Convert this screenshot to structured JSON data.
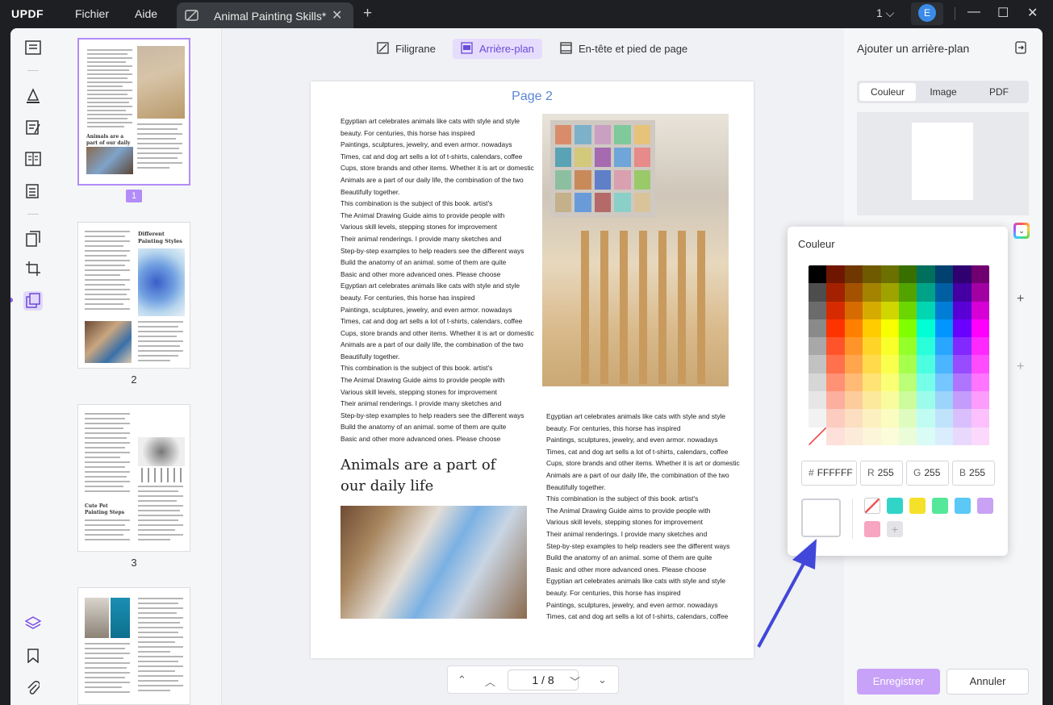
{
  "app": {
    "logo": "UPDF",
    "menu": [
      "Fichier",
      "Aide"
    ]
  },
  "tab": {
    "title": "Animal Painting Skills*"
  },
  "topbar": {
    "page_indicator": "1",
    "avatar_initial": "E"
  },
  "toolbar": {
    "watermark": "Filigrane",
    "background": "Arrière-plan",
    "header_footer": "En-tête et pied de page"
  },
  "thumbnails": {
    "pages": [
      "1",
      "2",
      "3"
    ]
  },
  "document": {
    "page_title": "Page 2",
    "col1_text": "Egyptian art celebrates animals like cats with style and style\nbeauty. For centuries, this horse has inspired\nPaintings, sculptures, jewelry, and even armor. nowadays\nTimes, cat and dog art sells a lot of t-shirts, calendars, coffee\nCups, store brands and other items. Whether it is art or domestic\nAnimals are a part of our daily life, the combination of the two\nBeautifully together.\nThis combination is the subject of this book. artist's\nThe Animal Drawing Guide aims to provide people with\nVarious skill levels, stepping stones for improvement\nTheir animal renderings. I provide many sketches and\nStep-by-step examples to help readers see the different ways\nBuild the anatomy of an animal. some of them are quite\nBasic and other more advanced ones. Please choose\nEgyptian art celebrates animals like cats with style and style\nbeauty. For centuries, this horse has inspired\nPaintings, sculptures, jewelry, and even armor. nowadays\nTimes, cat and dog art sells a lot of t-shirts, calendars, coffee\nCups, store brands and other items. Whether it is art or domestic\nAnimals are a part of our daily life, the combination of the two\nBeautifully together.\nThis combination is the subject of this book. artist's\nThe Animal Drawing Guide aims to provide people with\nVarious skill levels, stepping stones for improvement\nTheir animal renderings. I provide many sketches and\nStep-by-step examples to help readers see the different ways\nBuild the anatomy of an animal. some of them are quite\nBasic and other more advanced ones. Please choose",
    "heading": "Animals are a part of\nour daily life",
    "col2_text": "Egyptian art celebrates animals like cats with style and style\nbeauty. For centuries, this horse has inspired\nPaintings, sculptures, jewelry, and even armor. nowadays\nTimes, cat and dog art sells a lot of t-shirts, calendars, coffee\nCups, store brands and other items. Whether it is art or domestic\nAnimals are a part of our daily life, the combination of the two\nBeautifully together.\nThis combination is the subject of this book. artist's\nThe Animal Drawing Guide aims to provide people with\nVarious skill levels, stepping stones for improvement\nTheir animal renderings. I provide many sketches and\nStep-by-step examples to help readers see the different ways\nBuild the anatomy of an animal. some of them are quite\nBasic and other more advanced ones. Please choose\nEgyptian art celebrates animals like cats with style and style\nbeauty. For centuries, this horse has inspired\nPaintings, sculptures, jewelry, and even armor. nowadays\nTimes, cat and dog art sells a lot of t-shirts, calendars, coffee"
  },
  "pager": {
    "current": "1",
    "separator": "/",
    "total": "8"
  },
  "panel": {
    "title": "Ajouter un arrière-plan",
    "tabs": [
      "Couleur",
      "Image",
      "PDF"
    ],
    "save": "Enregistrer",
    "cancel": "Annuler"
  },
  "color_popup": {
    "title": "Couleur",
    "hex_label": "#",
    "hex": "FFFFFF",
    "r_label": "R",
    "r": "255",
    "g_label": "G",
    "g": "255",
    "b_label": "B",
    "b": "255",
    "selected_color": "#FFFFFF",
    "presets": [
      "#30d5c8",
      "#f5e12a",
      "#55e89a",
      "#5bc8f5",
      "#c9a2f5",
      "#f7a5c0"
    ]
  },
  "thumb_texts": {
    "p1_heading": "Animals are a part of our daily life",
    "p2_heading": "Different Painting Styles",
    "p3_heading": "Cute Pet Painting Steps"
  }
}
